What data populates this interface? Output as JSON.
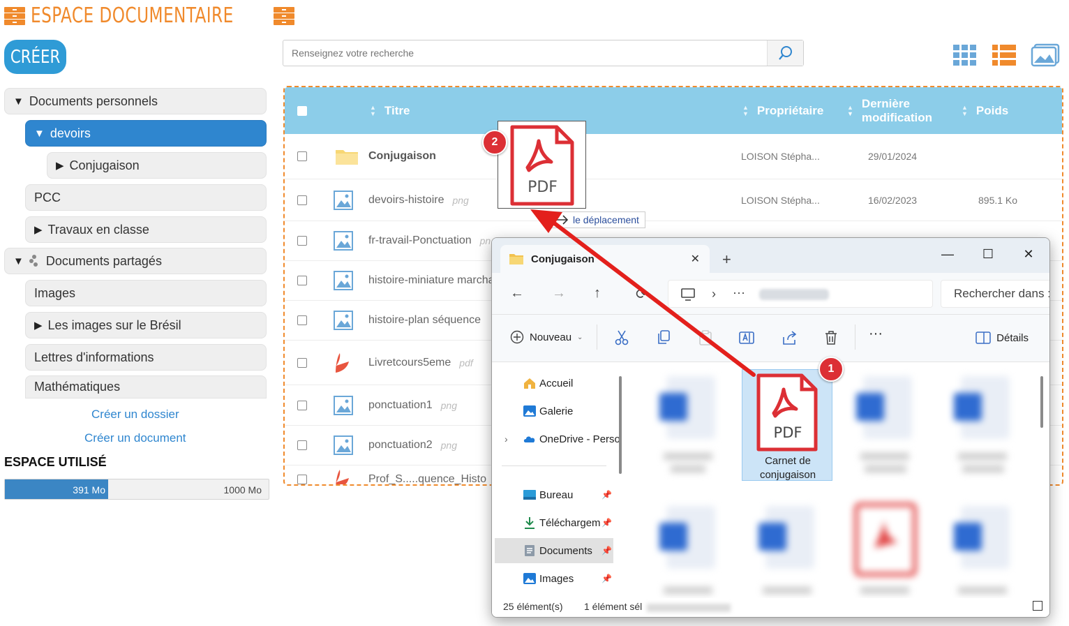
{
  "app": {
    "title": "ESPACE DOCUMENTAIRE",
    "create_label": "CRÉER"
  },
  "search": {
    "placeholder": "Renseignez votre recherche"
  },
  "sidebar": {
    "items": [
      {
        "label": "Documents personnels"
      },
      {
        "label": "devoirs"
      },
      {
        "label": "Conjugaison"
      },
      {
        "label": "PCC"
      },
      {
        "label": "Travaux en classe"
      },
      {
        "label": "Documents partagés"
      },
      {
        "label": "Images"
      },
      {
        "label": "Les images sur le Brésil"
      },
      {
        "label": "Lettres d'informations"
      },
      {
        "label": "Mathématiques"
      }
    ],
    "create_folder": "Créer un dossier",
    "create_document": "Créer un document"
  },
  "storage": {
    "title": "ESPACE UTILISÉ",
    "used": "391 Mo",
    "total": "1000 Mo",
    "used_fraction": 0.391
  },
  "table": {
    "headers": {
      "title": "Titre",
      "owner": "Propriétaire",
      "modified_line1": "Dernière",
      "modified_line2": "modification",
      "size": "Poids"
    },
    "rows": [
      {
        "name": "Conjugaison",
        "ext": "",
        "owner": "LOISON Stépha...",
        "date": "29/01/2024",
        "size": ""
      },
      {
        "name": "devoirs-histoire",
        "ext": "png",
        "owner": "LOISON Stépha...",
        "date": "16/02/2023",
        "size": "895.1 Ko"
      },
      {
        "name": "fr-travail-Ponctuation",
        "ext": "pn",
        "owner": "",
        "date": "",
        "size": ""
      },
      {
        "name": "histoire-miniature marcha",
        "ext": "",
        "owner": "",
        "date": "",
        "size": ""
      },
      {
        "name": "histoire-plan séquence",
        "ext": "",
        "owner": "",
        "date": "",
        "size": ""
      },
      {
        "name": "Livretcours5eme",
        "ext": "pdf",
        "owner": "",
        "date": "",
        "size": ""
      },
      {
        "name": "ponctuation1",
        "ext": "png",
        "owner": "",
        "date": "",
        "size": ""
      },
      {
        "name": "ponctuation2",
        "ext": "png",
        "owner": "",
        "date": "",
        "size": ""
      },
      {
        "name": "Prof_S.....quence_Histo",
        "ext": "",
        "owner": "",
        "date": "",
        "size": ""
      }
    ]
  },
  "drag": {
    "tooltip": "le déplacement",
    "badge": "2",
    "pdf_label": "PDF"
  },
  "explorer": {
    "tab_title": "Conjugaison",
    "search_placeholder": "Rechercher dans :",
    "toolbar": {
      "new_label": "Nouveau",
      "details_label": "Détails"
    },
    "nav": [
      {
        "label": "Accueil"
      },
      {
        "label": "Galerie"
      },
      {
        "label": "OneDrive - Perso"
      },
      {
        "label": "Bureau"
      },
      {
        "label": "Téléchargem"
      },
      {
        "label": "Documents"
      },
      {
        "label": "Images"
      }
    ],
    "selected_file": {
      "line1": "Carnet de",
      "line2": "conjugaison",
      "badge": "1",
      "pdf_label": "PDF"
    },
    "status": {
      "count": "25 élément(s)",
      "selection": "1 élément sél"
    }
  },
  "colors": {
    "accent_orange": "#f08a2c",
    "primary_blue": "#2f86cf",
    "header_blue": "#8ccde9",
    "badge_red": "#dc2f35",
    "arrow_red": "#e3201c"
  }
}
